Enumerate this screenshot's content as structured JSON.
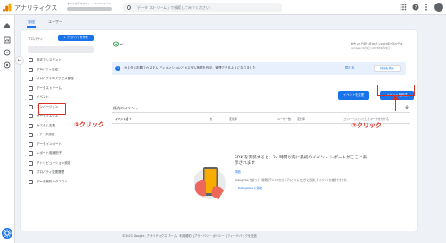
{
  "app": {
    "name": "アナリティクス",
    "account_path": "すべてのアカウント > Techcogram",
    "search_placeholder": "「データ ストリーム」で検索してみてください"
  },
  "admin_tabs": [
    {
      "label": "管理",
      "active": true
    },
    {
      "label": "ユーザー",
      "active": false
    }
  ],
  "property": {
    "label": "プロパティ",
    "create_button": "+ プロパティを作成",
    "menu": [
      {
        "label": "設定アシスタント",
        "icon": "checklist-icon"
      },
      {
        "label": "プロパティ設定",
        "icon": "settings-icon"
      },
      {
        "label": "プロパティのアクセス管理",
        "icon": "people-icon"
      },
      {
        "label": "データストリーム",
        "icon": "stream-icon"
      },
      {
        "label": "イベント",
        "icon": "event-icon"
      },
      {
        "label": "コンバージョン",
        "icon": "flag-icon"
      },
      {
        "label": "オーディエンス",
        "icon": "audience-icon"
      },
      {
        "label": "カスタム定義",
        "icon": "custom-definitions-icon"
      },
      {
        "label": "▸ データ設定",
        "icon": "data-settings-icon"
      },
      {
        "label": "データインポート",
        "icon": "import-icon"
      },
      {
        "label": "レポート用識別子",
        "icon": "identity-icon"
      },
      {
        "label": "アトリビューション設定",
        "icon": "attribution-icon"
      },
      {
        "label": "プロパティ変更履歴",
        "icon": "history-icon"
      },
      {
        "label": "データ削除リクエスト",
        "icon": "delete-request-icon"
      }
    ]
  },
  "date_range": {
    "label": "過去 28 日間 6月30日〜2023年7月27日 ▾",
    "compare": "Compare: 6月2日〜2023年6月29日"
  },
  "banner": {
    "text": "カスタム定義でカスタム ディメンションとカスタム指標を作成、管理できるようになりました",
    "close": "閉じる",
    "detail": "詳細を表示"
  },
  "buttons": {
    "modify_event": "イベントを変更",
    "create_event": "イベントを作成"
  },
  "existing_events": {
    "title": "既存のイベント",
    "columns": [
      "イベント名 ↑",
      "数",
      "変化率",
      "ユーザー数",
      "変化率",
      "コンバージョンとしてマークを付ける"
    ]
  },
  "empty_state": {
    "title": "SDK を実装すると、24 時間以内に最初のイベント レポートがここに表示されます",
    "link": "詳細",
    "sub": "DebugView を使って、開発用デバイスからリアルタイムでログに記録したイベントを確認できます。",
    "link2": "DebugView に移動"
  },
  "annotations": {
    "step1": "①クリック",
    "step2": "②クリック"
  },
  "footer": "©2023 Google | アナリティクス ホーム | 利用規約 | プライバシー ポリシー | フィードバックを送信",
  "colors": {
    "primary": "#1a73e8",
    "annotation_red": "#d93025",
    "brand_orange": "#f9ab00"
  }
}
